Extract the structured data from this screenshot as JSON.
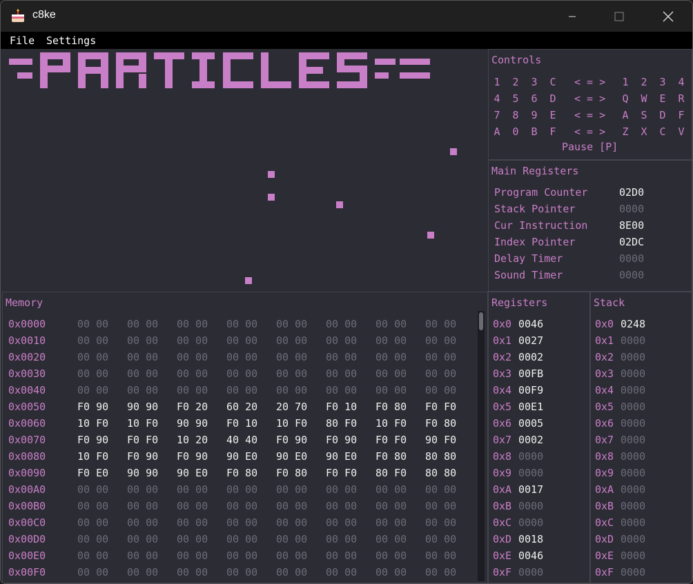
{
  "window": {
    "title": "c8ke"
  },
  "menu": [
    "File",
    "Settings"
  ],
  "controls": {
    "title": "Controls",
    "rows": [
      {
        "chip": [
          "1",
          "2",
          "3",
          "C"
        ],
        "arrows": "< = >",
        "keys": [
          "1",
          "2",
          "3",
          "4"
        ]
      },
      {
        "chip": [
          "4",
          "5",
          "6",
          "D"
        ],
        "arrows": "< = >",
        "keys": [
          "Q",
          "W",
          "E",
          "R"
        ]
      },
      {
        "chip": [
          "7",
          "8",
          "9",
          "E"
        ],
        "arrows": "< = >",
        "keys": [
          "A",
          "S",
          "D",
          "F"
        ]
      },
      {
        "chip": [
          "A",
          "0",
          "B",
          "F"
        ],
        "arrows": "< = >",
        "keys": [
          "Z",
          "X",
          "C",
          "V"
        ]
      }
    ],
    "pause": "Pause [P]"
  },
  "main_registers": {
    "title": "Main Registers",
    "items": [
      {
        "label": "Program Counter",
        "value": "02D0",
        "active": true
      },
      {
        "label": "Stack Pointer",
        "value": "0000",
        "active": false
      },
      {
        "label": "Cur Instruction",
        "value": "8E00",
        "active": true
      },
      {
        "label": "Index Pointer",
        "value": "02DC",
        "active": true
      },
      {
        "label": "Delay Timer",
        "value": "0000",
        "active": false
      },
      {
        "label": "Sound Timer",
        "value": "0000",
        "active": false
      }
    ]
  },
  "memory": {
    "title": "Memory",
    "rows": [
      {
        "addr": "0x0000",
        "pairs": [
          "00 00",
          "00 00",
          "00 00",
          "00 00",
          "00 00",
          "00 00",
          "00 00",
          "00 00"
        ]
      },
      {
        "addr": "0x0010",
        "pairs": [
          "00 00",
          "00 00",
          "00 00",
          "00 00",
          "00 00",
          "00 00",
          "00 00",
          "00 00"
        ]
      },
      {
        "addr": "0x0020",
        "pairs": [
          "00 00",
          "00 00",
          "00 00",
          "00 00",
          "00 00",
          "00 00",
          "00 00",
          "00 00"
        ]
      },
      {
        "addr": "0x0030",
        "pairs": [
          "00 00",
          "00 00",
          "00 00",
          "00 00",
          "00 00",
          "00 00",
          "00 00",
          "00 00"
        ]
      },
      {
        "addr": "0x0040",
        "pairs": [
          "00 00",
          "00 00",
          "00 00",
          "00 00",
          "00 00",
          "00 00",
          "00 00",
          "00 00"
        ]
      },
      {
        "addr": "0x0050",
        "pairs": [
          "F0 90",
          "90 90",
          "F0 20",
          "60 20",
          "20 70",
          "F0 10",
          "F0 80",
          "F0 F0"
        ]
      },
      {
        "addr": "0x0060",
        "pairs": [
          "10 F0",
          "10 F0",
          "90 90",
          "F0 10",
          "10 F0",
          "80 F0",
          "10 F0",
          "F0 80"
        ]
      },
      {
        "addr": "0x0070",
        "pairs": [
          "F0 90",
          "F0 F0",
          "10 20",
          "40 40",
          "F0 90",
          "F0 90",
          "F0 F0",
          "90 F0"
        ]
      },
      {
        "addr": "0x0080",
        "pairs": [
          "10 F0",
          "F0 90",
          "F0 90",
          "90 E0",
          "90 E0",
          "90 E0",
          "F0 80",
          "80 80"
        ]
      },
      {
        "addr": "0x0090",
        "pairs": [
          "F0 E0",
          "90 90",
          "90 E0",
          "F0 80",
          "F0 80",
          "F0 F0",
          "80 F0",
          "80 80"
        ]
      },
      {
        "addr": "0x00A0",
        "pairs": [
          "00 00",
          "00 00",
          "00 00",
          "00 00",
          "00 00",
          "00 00",
          "00 00",
          "00 00"
        ]
      },
      {
        "addr": "0x00B0",
        "pairs": [
          "00 00",
          "00 00",
          "00 00",
          "00 00",
          "00 00",
          "00 00",
          "00 00",
          "00 00"
        ]
      },
      {
        "addr": "0x00C0",
        "pairs": [
          "00 00",
          "00 00",
          "00 00",
          "00 00",
          "00 00",
          "00 00",
          "00 00",
          "00 00"
        ]
      },
      {
        "addr": "0x00D0",
        "pairs": [
          "00 00",
          "00 00",
          "00 00",
          "00 00",
          "00 00",
          "00 00",
          "00 00",
          "00 00"
        ]
      },
      {
        "addr": "0x00E0",
        "pairs": [
          "00 00",
          "00 00",
          "00 00",
          "00 00",
          "00 00",
          "00 00",
          "00 00",
          "00 00"
        ]
      },
      {
        "addr": "0x00F0",
        "pairs": [
          "00 00",
          "00 00",
          "00 00",
          "00 00",
          "00 00",
          "00 00",
          "00 00",
          "00 00"
        ]
      }
    ]
  },
  "registers": {
    "title": "Registers",
    "items": [
      {
        "idx": "0x0",
        "value": "0046"
      },
      {
        "idx": "0x1",
        "value": "0027"
      },
      {
        "idx": "0x2",
        "value": "0002"
      },
      {
        "idx": "0x3",
        "value": "00FB"
      },
      {
        "idx": "0x4",
        "value": "00F9"
      },
      {
        "idx": "0x5",
        "value": "00E1"
      },
      {
        "idx": "0x6",
        "value": "0005"
      },
      {
        "idx": "0x7",
        "value": "0002"
      },
      {
        "idx": "0x8",
        "value": "0000"
      },
      {
        "idx": "0x9",
        "value": "0000"
      },
      {
        "idx": "0xA",
        "value": "0017"
      },
      {
        "idx": "0xB",
        "value": "0000"
      },
      {
        "idx": "0xC",
        "value": "0000"
      },
      {
        "idx": "0xD",
        "value": "0018"
      },
      {
        "idx": "0xE",
        "value": "0046"
      },
      {
        "idx": "0xF",
        "value": "0000"
      }
    ]
  },
  "stack": {
    "title": "Stack",
    "items": [
      {
        "idx": "0x0",
        "value": "0248"
      },
      {
        "idx": "0x1",
        "value": "0000"
      },
      {
        "idx": "0x2",
        "value": "0000"
      },
      {
        "idx": "0x3",
        "value": "0000"
      },
      {
        "idx": "0x4",
        "value": "0000"
      },
      {
        "idx": "0x5",
        "value": "0000"
      },
      {
        "idx": "0x6",
        "value": "0000"
      },
      {
        "idx": "0x7",
        "value": "0000"
      },
      {
        "idx": "0x8",
        "value": "0000"
      },
      {
        "idx": "0x9",
        "value": "0000"
      },
      {
        "idx": "0xA",
        "value": "0000"
      },
      {
        "idx": "0xB",
        "value": "0000"
      },
      {
        "idx": "0xC",
        "value": "0000"
      },
      {
        "idx": "0xD",
        "value": "0000"
      },
      {
        "idx": "0xE",
        "value": "0000"
      },
      {
        "idx": "0xF",
        "value": "0000"
      }
    ]
  },
  "display": {
    "banner_text": "PARTICLES",
    "pixel_color": "#c97fc8",
    "background": "#2c2c34"
  },
  "icons": {
    "app": "cake-icon",
    "minimize": "minimize-icon",
    "maximize": "maximize-icon",
    "close": "close-icon"
  }
}
